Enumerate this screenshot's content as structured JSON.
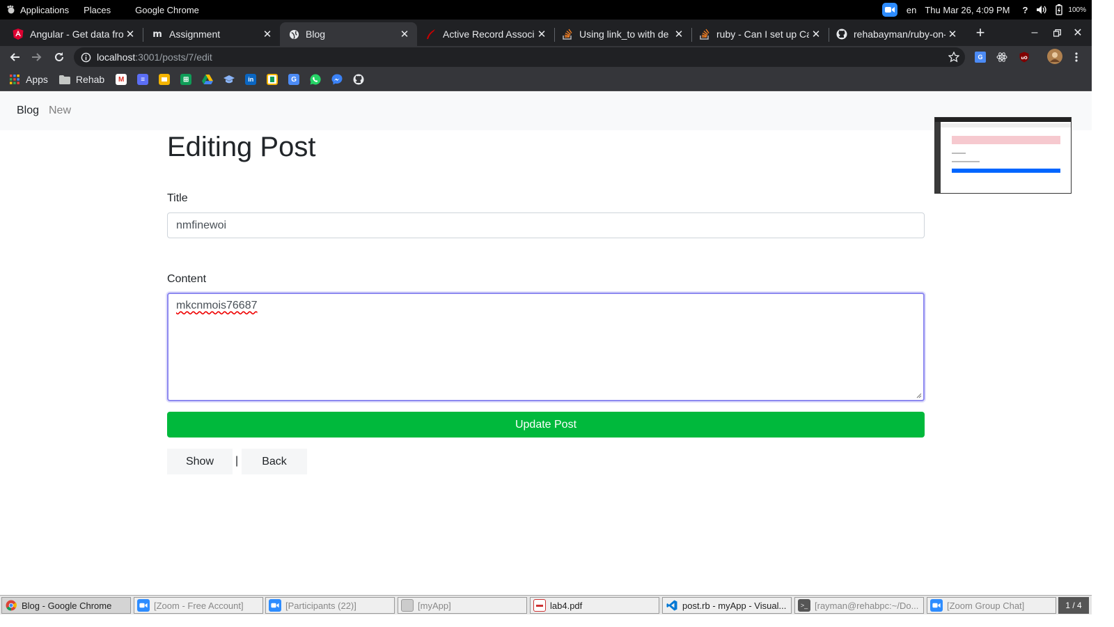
{
  "system_bar": {
    "applications": "Applications",
    "places": "Places",
    "active_app": "Google Chrome",
    "language": "en",
    "datetime": "Thu Mar 26,  4:09 PM",
    "battery": "100%"
  },
  "tabs": [
    {
      "title": "Angular - Get data fro",
      "favicon": "angular-icon"
    },
    {
      "title": "Assignment",
      "favicon": "moodle-icon"
    },
    {
      "title": "Blog",
      "favicon": "globe-icon",
      "active": true
    },
    {
      "title": "Active Record Associ",
      "favicon": "rails-icon"
    },
    {
      "title": "Using link_to with de",
      "favicon": "stackoverflow-icon"
    },
    {
      "title": "ruby - Can I set up Ca",
      "favicon": "stackoverflow-icon"
    },
    {
      "title": "rehabayman/ruby-on-",
      "favicon": "github-icon"
    }
  ],
  "address_bar": {
    "host": "localhost",
    "path": ":3001/posts/7/edit"
  },
  "bookmarks": {
    "apps": "Apps",
    "folder": "Rehab"
  },
  "page": {
    "brand": "Blog",
    "nav_new": "New",
    "heading": "Editing Post",
    "title_label": "Title",
    "title_value": "nmfinewoi",
    "content_label": "Content",
    "content_value": "mkcnmois76687",
    "submit_label": "Update Post",
    "show_label": "Show",
    "separator": "|",
    "back_label": "Back"
  },
  "taskbar": {
    "items": [
      {
        "label": "Blog - Google Chrome"
      },
      {
        "label": "[Zoom - Free Account]"
      },
      {
        "label": "[Participants (22)]"
      },
      {
        "label": "[myApp]"
      },
      {
        "label": "lab4.pdf"
      },
      {
        "label": "post.rb - myApp - Visual..."
      },
      {
        "label": "[rayman@rehabpc:~/Do..."
      },
      {
        "label": "[Zoom Group Chat]"
      }
    ],
    "pager": "1 / 4"
  },
  "colors": {
    "submit_button": "#00b93c",
    "focus_ring": "#8c88f0",
    "navbar_bg": "#f8f9fa"
  }
}
